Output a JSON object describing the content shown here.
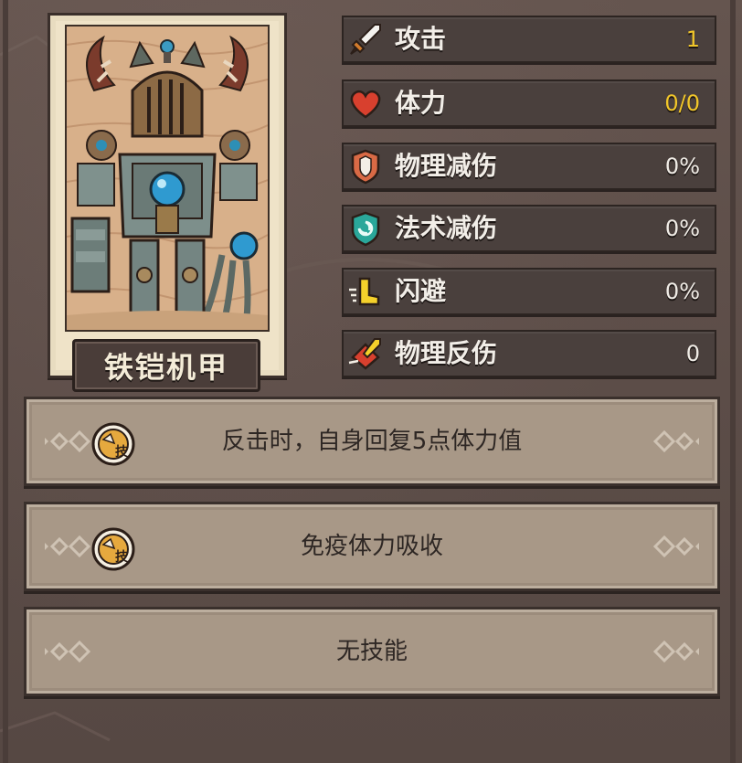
{
  "card": {
    "name": "铁铠机甲",
    "art_icon": "mech-knight-art"
  },
  "stats": [
    {
      "label": "攻击",
      "value": "1",
      "icon": "sword-icon",
      "color": "#f1c62a"
    },
    {
      "label": "体力",
      "value": "0/0",
      "icon": "heart-icon",
      "color": "#f1c62a"
    },
    {
      "label": "物理减伤",
      "value": "0%",
      "icon": "physical-shield-icon",
      "color": "#f0ece6"
    },
    {
      "label": "法术减伤",
      "value": "0%",
      "icon": "magic-shield-icon",
      "color": "#f0ece6"
    },
    {
      "label": "闪避",
      "value": "0%",
      "icon": "dodge-boot-icon",
      "color": "#f0ece6"
    },
    {
      "label": "物理反伤",
      "value": "0",
      "icon": "reflect-damage-icon",
      "color": "#f0ece6"
    }
  ],
  "skills": [
    {
      "text": "反击时，自身回复5点体力值",
      "has_icon": true,
      "icon_label": "技"
    },
    {
      "text": "免疫体力吸收",
      "has_icon": true,
      "icon_label": "技"
    },
    {
      "text": "无技能",
      "has_icon": false
    }
  ],
  "colors": {
    "background": "#5f504b",
    "stat_box": "#4a403d",
    "skill_panel": "#a89887",
    "gold_value": "#f1c62a"
  }
}
